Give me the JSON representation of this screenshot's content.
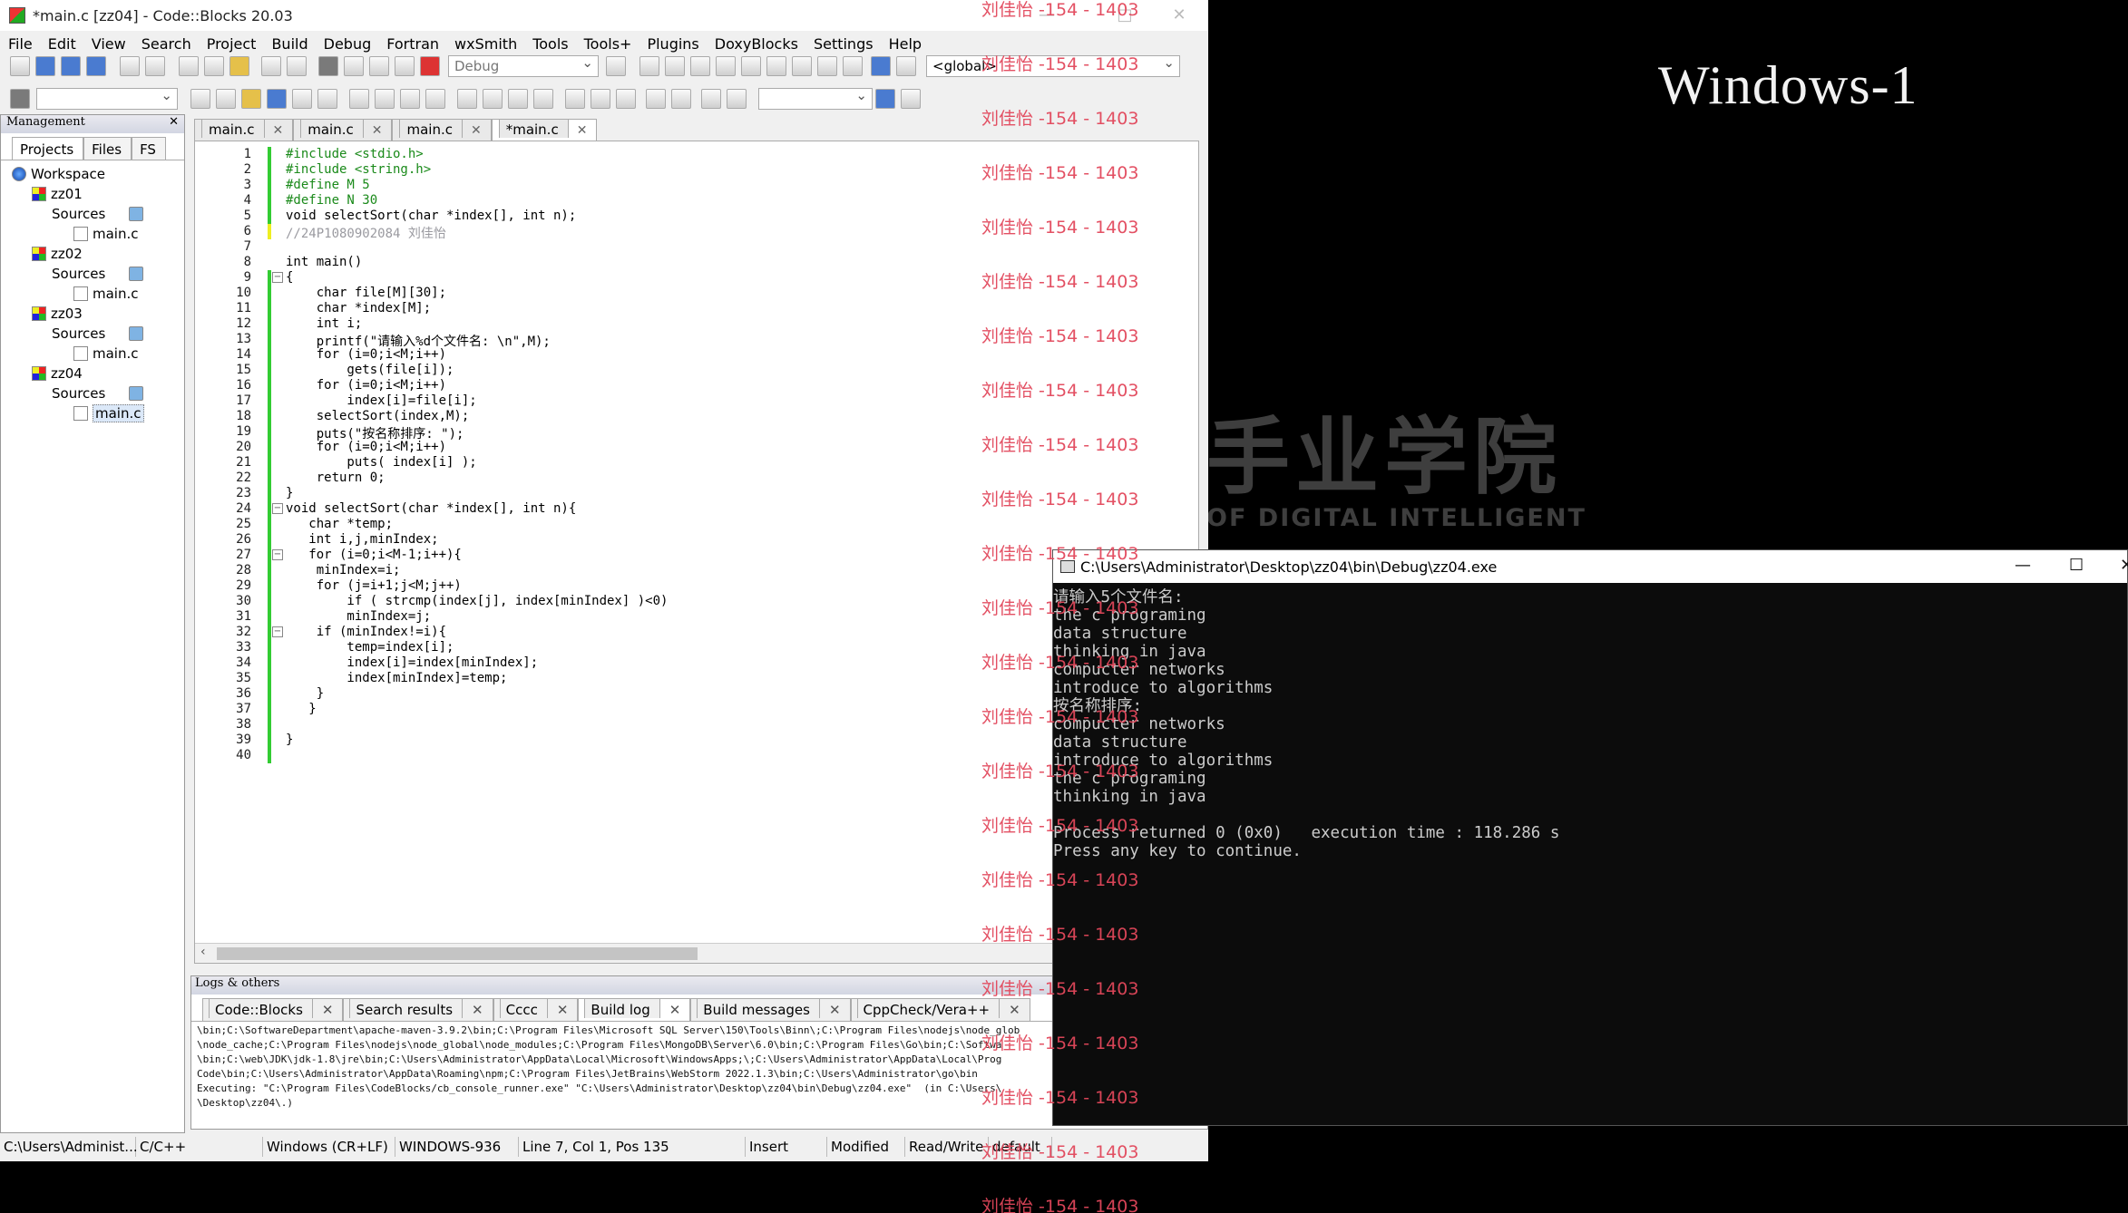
{
  "desktop": {
    "title": "Windows-1",
    "bg_cn": "手业学院",
    "bg_en": "OF  DIGITAL INTELLIGENT"
  },
  "window": {
    "title": "*main.c [zz04] - Code::Blocks 20.03"
  },
  "menu": [
    "File",
    "Edit",
    "View",
    "Search",
    "Project",
    "Build",
    "Debug",
    "Fortran",
    "wxSmith",
    "Tools",
    "Tools+",
    "Plugins",
    "DoxyBlocks",
    "Settings",
    "Help"
  ],
  "toolbar": {
    "build_target": "Debug",
    "scope": "<global>"
  },
  "management": {
    "title": "Management",
    "tabs": [
      "Projects",
      "Files",
      "FS"
    ],
    "workspace": "Workspace",
    "projects": [
      {
        "name": "zz01",
        "folder": "Sources",
        "file": "main.c"
      },
      {
        "name": "zz02",
        "folder": "Sources",
        "file": "main.c"
      },
      {
        "name": "zz03",
        "folder": "Sources",
        "file": "main.c"
      },
      {
        "name": "zz04",
        "folder": "Sources",
        "file": "main.c"
      }
    ]
  },
  "editor_tabs": [
    "main.c",
    "main.c",
    "main.c",
    "*main.c"
  ],
  "code_lines": [
    "#include <stdio.h>",
    "#include <string.h>",
    "#define M 5",
    "#define N 30",
    "void selectSort(char *index[], int n);",
    "//24P1080902084 刘佳怡",
    "",
    "int main()",
    "{",
    "    char file[M][30];",
    "    char *index[M];",
    "    int i;",
    "    printf(\"请输入%d个文件名: \\n\",M);",
    "    for (i=0;i<M;i++)",
    "        gets(file[i]);",
    "    for (i=0;i<M;i++)",
    "        index[i]=file[i];",
    "    selectSort(index,M);",
    "    puts(\"按名称排序: \");",
    "    for (i=0;i<M;i++)",
    "        puts( index[i] );",
    "    return 0;",
    "}",
    "void selectSort(char *index[], int n){",
    "   char *temp;",
    "   int i,j,minIndex;",
    "   for (i=0;i<M-1;i++){",
    "    minIndex=i;",
    "    for (j=i+1;j<M;j++)",
    "        if ( strcmp(index[j], index[minIndex] )<0)",
    "        minIndex=j;",
    "    if (minIndex!=i){",
    "        temp=index[i];",
    "        index[i]=index[minIndex];",
    "        index[minIndex]=temp;",
    "    }",
    "   }",
    "",
    "}",
    ""
  ],
  "logs": {
    "title": "Logs & others",
    "tabs": [
      "Code::Blocks",
      "Search results",
      "Cccc",
      "Build log",
      "Build messages",
      "CppCheck/Vera++"
    ],
    "lines": [
      "\\bin;C:\\SoftwareDepartment\\apache-maven-3.9.2\\bin;C:\\Program Files\\Microsoft SQL Server\\150\\Tools\\Binn\\;C:\\Program Files\\nodejs\\node_glob",
      "\\node_cache;C:\\Program Files\\nodejs\\node_global\\node_modules;C:\\Program Files\\MongoDB\\Server\\6.0\\bin;C:\\Program Files\\Go\\bin;C:\\Softwa",
      "\\bin;C:\\web\\JDK\\jdk-1.8\\jre\\bin;C:\\Users\\Administrator\\AppData\\Local\\Microsoft\\WindowsApps;\\;C:\\Users\\Administrator\\AppData\\Local\\Prog",
      "Code\\bin;C:\\Users\\Administrator\\AppData\\Roaming\\npm;C:\\Program Files\\JetBrains\\WebStorm 2022.1.3\\bin;C:\\Users\\Administrator\\go\\bin",
      "Executing: \"C:\\Program Files\\CodeBlocks/cb_console_runner.exe\" \"C:\\Users\\Administrator\\Desktop\\zz04\\bin\\Debug\\zz04.exe\"  (in C:\\Users\\",
      "\\Desktop\\zz04\\.)"
    ]
  },
  "status": [
    "C:\\Users\\Administ...",
    "C/C++",
    "Windows (CR+LF)",
    "WINDOWS-936",
    "Line 7, Col 1, Pos 135",
    "Insert",
    "Modified",
    "Read/Write",
    "default"
  ],
  "console": {
    "title": "C:\\Users\\Administrator\\Desktop\\zz04\\bin\\Debug\\zz04.exe",
    "lines": [
      "请输入5个文件名:",
      "the c programing",
      "data structure",
      "thinking in java",
      "compucter networks",
      "introduce to algorithms",
      "按名称排序:",
      "compucter networks",
      "data structure",
      "introduce to algorithms",
      "the c programing",
      "thinking in java",
      "",
      "Process returned 0 (0x0)   execution time : 118.286 s",
      "Press any key to continue."
    ]
  },
  "watermark": "刘佳怡 -154 - 1403",
  "colors": {
    "code_green": "#3c3",
    "keyword": "#00008b",
    "string": "#0000ff",
    "watermark": "#e2475b"
  }
}
